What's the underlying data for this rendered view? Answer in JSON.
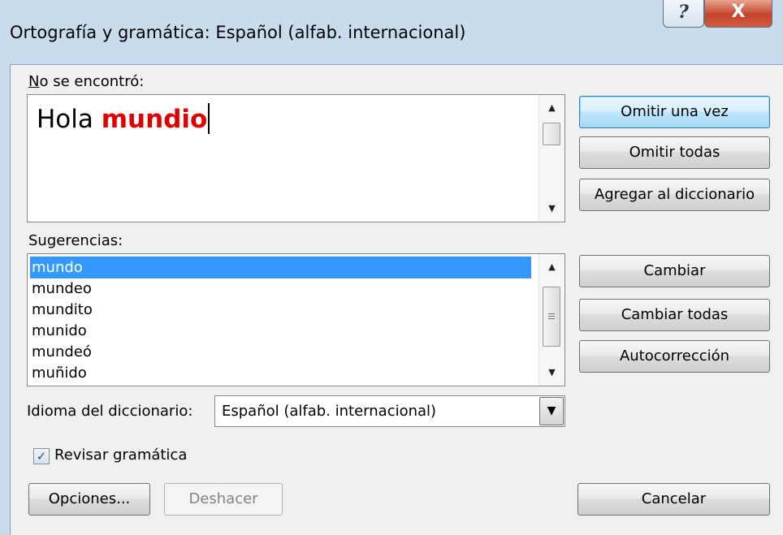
{
  "window": {
    "title": "Ortografía y gramática: Español (alfab. internacional)",
    "help_glyph": "?",
    "close_glyph": "X"
  },
  "not_found": {
    "label": "No se encontró:",
    "text_before": "Hola ",
    "flagged_word": "mundio",
    "flagged_color": "#e10000"
  },
  "suggestions": {
    "label": "Sugerencias:",
    "items": [
      "mundo",
      "mundeo",
      "mundito",
      "munido",
      "mundeó",
      "muñido"
    ],
    "selected": "mundo",
    "selection_color": "#3399ff"
  },
  "language": {
    "label": "Idioma del diccionario:",
    "value": "Español (alfab. internacional)"
  },
  "grammar": {
    "label": "Revisar gramática",
    "checked": true
  },
  "buttons": {
    "ignore_once": "Omitir una vez",
    "ignore_all": "Omitir todas",
    "add_to_dictionary": "Agregar al diccionario",
    "change": "Cambiar",
    "change_all": "Cambiar todas",
    "autocorrect": "Autocorrección",
    "options": "Opciones...",
    "undo": "Deshacer",
    "cancel": "Cancelar"
  },
  "icons": {
    "scroll_up": "▲",
    "scroll_down": "▼",
    "dropdown": "▼",
    "check": "✓"
  }
}
